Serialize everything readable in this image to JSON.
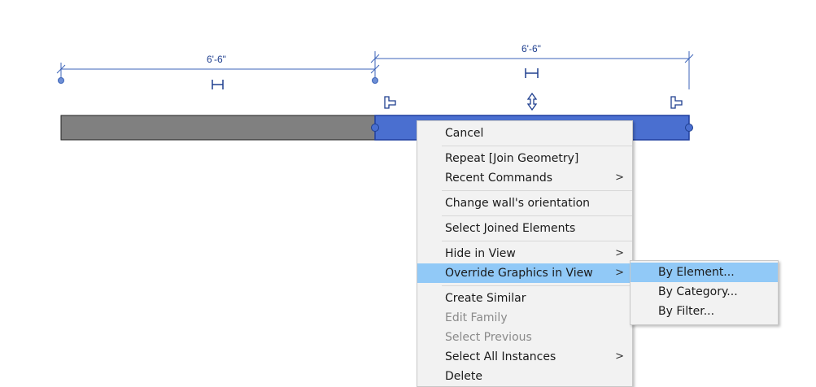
{
  "dimensions": {
    "left_label": "6'-6\"",
    "right_label": "6'-6\""
  },
  "context_menu": {
    "cancel": "Cancel",
    "repeat": "Repeat [Join Geometry]",
    "recent_commands": "Recent Commands",
    "change_orientation": "Change wall's orientation",
    "select_joined": "Select Joined Elements",
    "hide_in_view": "Hide in View",
    "override_graphics": "Override Graphics in View",
    "create_similar": "Create Similar",
    "edit_family": "Edit Family",
    "select_previous": "Select Previous",
    "select_all_instances": "Select All Instances",
    "delete": "Delete"
  },
  "submenu": {
    "by_element": "By Element...",
    "by_category": "By Category...",
    "by_filter": "By Filter..."
  },
  "glyphs": {
    "submenu_arrow": ">"
  },
  "colors": {
    "selected_wall": "#4a6fd0",
    "unselected_wall": "#808080",
    "dimension_line": "#3b63b8",
    "menu_highlight": "#91c9f7"
  },
  "icons": [
    "dimension-lock-icon",
    "flip-orientation-icon",
    "wall-end-grip-icon"
  ]
}
